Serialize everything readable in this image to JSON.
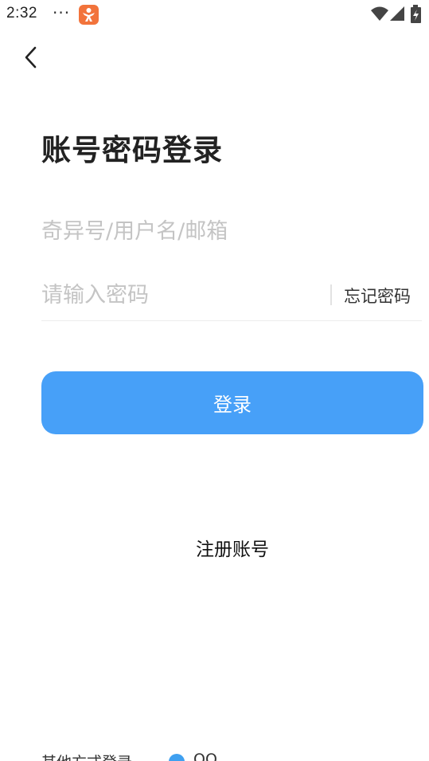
{
  "status_bar": {
    "time": "2:32",
    "dots": "···",
    "badge_color": "#f2733b"
  },
  "header": {
    "back_icon": "chevron-left-icon",
    "title": "账号密码登录"
  },
  "form": {
    "account_placeholder": "奇异号/用户名/邮箱",
    "password_placeholder": "请输入密码",
    "forgot_label": "忘记密码"
  },
  "actions": {
    "login_label": "登录",
    "login_color": "#47a0f8",
    "register_label": "注册账号"
  },
  "other": {
    "label": "其他方式登录",
    "qq_icon": "qq-icon",
    "qq_label": "QQ"
  }
}
